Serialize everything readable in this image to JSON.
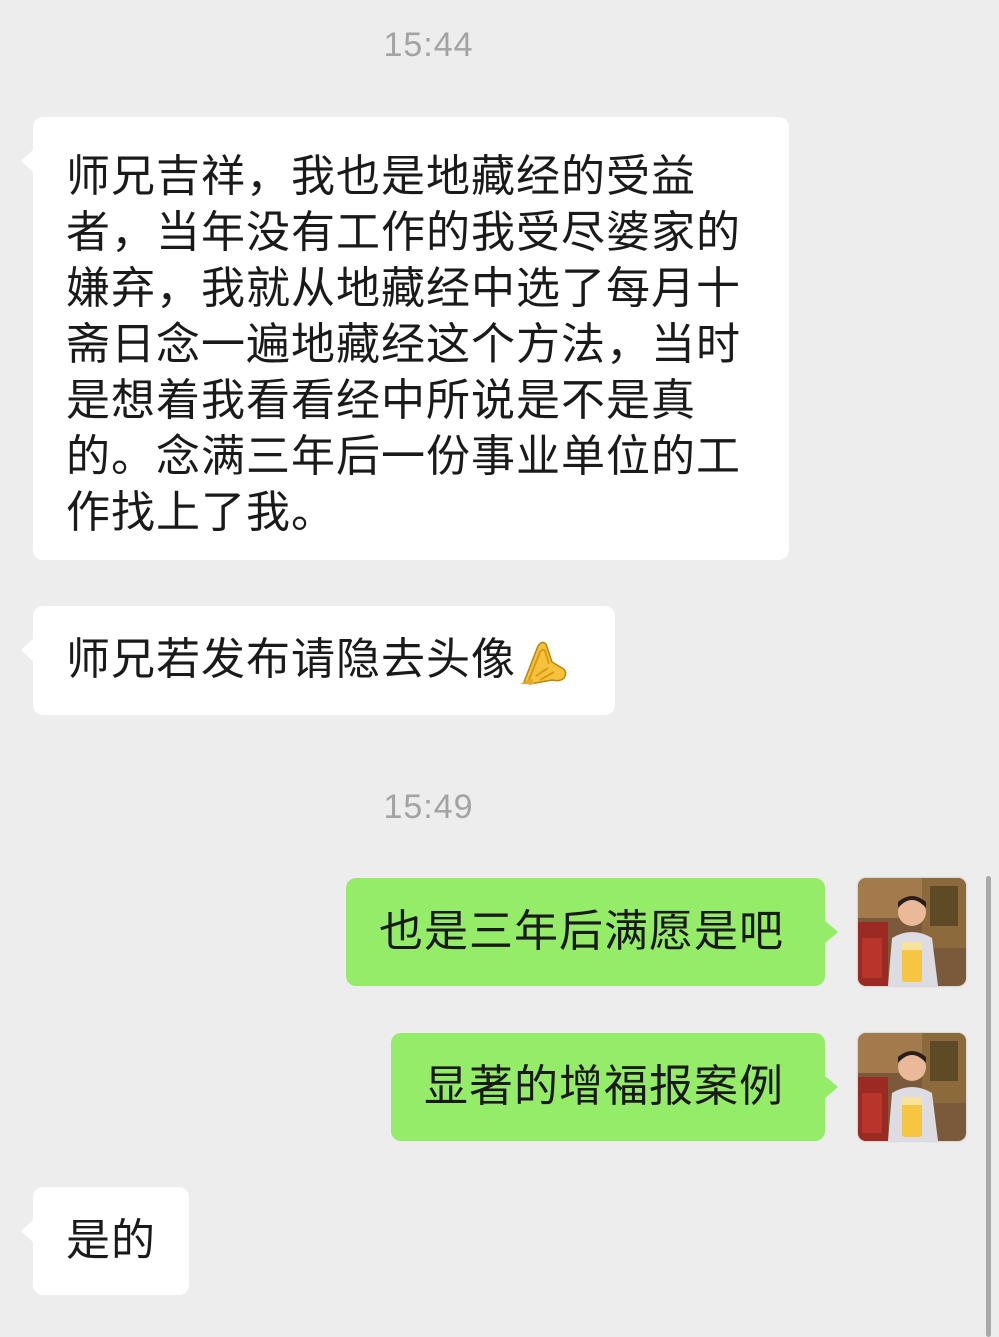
{
  "chat": {
    "timestamps": [
      "15:44",
      "15:49"
    ],
    "messages": [
      {
        "from": "other",
        "text": "师兄吉祥，我也是地藏经的受益者，当年没有工作的我受尽婆家的嫌弃，我就从地藏经中选了每月十斋日念一遍地藏经这个方法，当时是想着我看看经中所说是不是真的。念满三年后一份事业单位的工作找上了我。"
      },
      {
        "from": "other",
        "text": "师兄若发布请隐去头像",
        "emoji": "folded-hands-emoji"
      },
      {
        "from": "self",
        "text": "也是三年后满愿是吧"
      },
      {
        "from": "self",
        "text": "显著的增福报案例"
      },
      {
        "from": "other",
        "text": "是的"
      }
    ]
  },
  "colors": {
    "background": "#ededed",
    "incoming_bubble": "#ffffff",
    "outgoing_bubble": "#95ec69",
    "timestamp": "#a3a3a3"
  }
}
